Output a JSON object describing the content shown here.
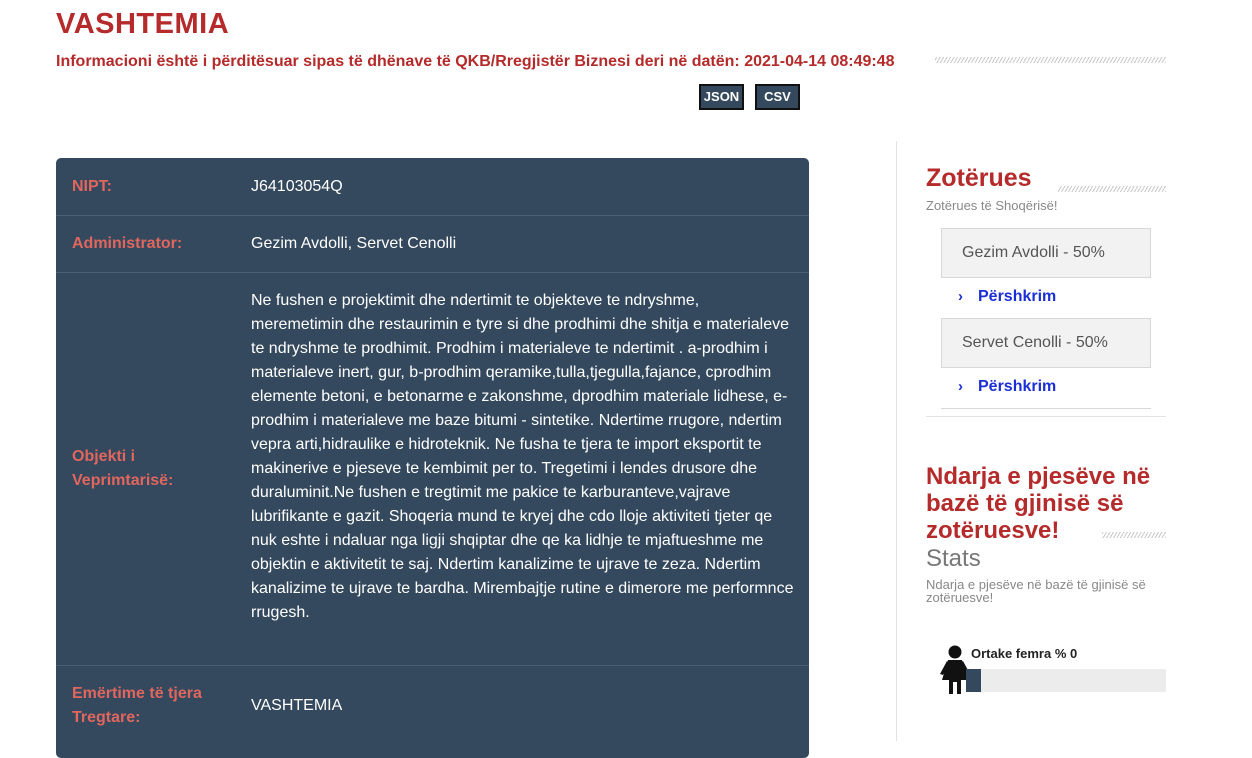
{
  "header": {
    "company_name": "VASHTEMIA",
    "update_notice": "Informacioni është i përditësuar sipas të dhënave të QKB/Rregjistër Biznesi deri në datën: 2021-04-14 08:49:48",
    "json_button": "JSON",
    "csv_button": "CSV"
  },
  "info": {
    "nipt_label": "NIPT:",
    "nipt_value": "J64103054Q",
    "admin_label": "Administrator:",
    "admin_value": "Gezim Avdolli, Servet Cenolli",
    "object_label": "Objekti i Veprimtarisë:",
    "object_value": "Ne fushen e projektimit dhe ndertimit te objekteve te ndryshme, meremetimin dhe restaurimin e tyre si dhe prodhimi dhe shitja e materialeve te ndryshme te prodhimit. Prodhim i materialeve te ndertimit . a-prodhim i materialeve inert, gur, b-prodhim qeramike,tulla,tjegulla,fajance, cprodhim elemente betoni, e betonarme e zakonshme, dprodhim materiale lidhese, e-prodhim i materialeve me baze bitumi - sintetike. Ndertime rrugore, ndertim vepra arti,hidraulike e hidroteknik. Ne fusha te tjera te import eksportit te makinerive e pjeseve te kembimit per to. Tregetimi i lendes drusore dhe duraluminit.Ne fushen e tregtimit me pakice te karburanteve,vajrave lubrifikante e gazit. Shoqeria mund te kryej dhe cdo lloje aktiviteti tjeter qe nuk eshte i ndaluar nga ligji shqiptar dhe qe ka lidhje te mjaftueshme me objektin e aktivitetit te saj. Ndertim kanalizime te ujrave te zeza. Ndertim kanalizime te ujrave te bardha. Mirembajtje rutine e dimerore me performnce rrugesh.",
    "trade_names_label": "Emërtime të tjera Tregtare:",
    "trade_names_value": "VASHTEMIA"
  },
  "owners_section": {
    "title": "Zotërues",
    "subtitle": "Zotërues të Shoqërisë!",
    "owners": [
      {
        "name": "Gezim Avdolli - 50%",
        "link_label": "Përshkrim"
      },
      {
        "name": "Servet Cenolli - 50%",
        "link_label": "Përshkrim"
      }
    ]
  },
  "stats_section": {
    "title": "Ndarja e pjesëve në bazë të gjinisë së zotëruesve!",
    "stats_label": "Stats",
    "subtitle": "Ndarja e pjesëve në bazë të gjinisë së zotëruesve!",
    "female_label": "Ortake femra % 0",
    "female_percent": 0
  },
  "colors": {
    "brand_red": "#b52a2a",
    "card_bg": "#34495e",
    "label_red": "#e0665e",
    "link_blue": "#1b2fd6"
  },
  "icons": {
    "link_chevron": "chevron-right-icon",
    "female": "female-person-icon"
  }
}
